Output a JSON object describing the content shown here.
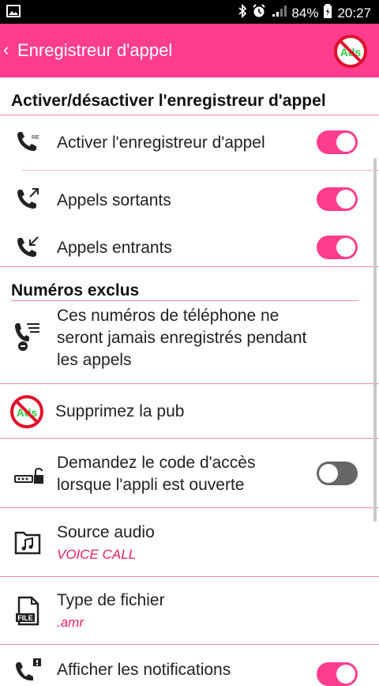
{
  "status_bar": {
    "battery": "84%",
    "time": "20:27",
    "icons": [
      "image-icon",
      "bluetooth-icon",
      "alarm-icon",
      "signal-icon",
      "battery-icon"
    ]
  },
  "app_bar": {
    "back_symbol": "‹",
    "title": "Enregistreur d'appel",
    "ads_text": "Ads"
  },
  "sections": {
    "recorder": {
      "header": "Activer/désactiver l'enregistreur d'appel",
      "items": [
        {
          "label": "Activer l'enregistreur d'appel",
          "icon": "phone-rec-icon",
          "toggle": true
        },
        {
          "label": "Appels sortants",
          "icon": "outgoing-call-icon",
          "toggle": true
        },
        {
          "label": "Appels entrants",
          "icon": "incoming-call-icon",
          "toggle": true
        }
      ]
    },
    "excluded": {
      "header": "Numéros exclus",
      "description_lines": [
        "Ces numéros de téléphone ne",
        "seront jamais enregistrés pendant",
        "les appels"
      ]
    },
    "remove_ads": {
      "label": "Supprimez la pub",
      "ads_text": "Ads"
    },
    "access_code": {
      "lines": [
        "Demandez le code d'accès",
        "lorsque l'appli est ouverte"
      ],
      "toggle": false
    },
    "audio_source": {
      "label": "Source audio",
      "value": "VOICE CALL"
    },
    "file_type": {
      "label": "Type de fichier",
      "value": ".amr",
      "icon_text": "FILE"
    },
    "notifications": {
      "label": "Afficher les notifications",
      "toggle": true
    }
  },
  "colors": {
    "accent": "#ff3d8f",
    "divider": "#f08aa6",
    "sub_value": "#e91e63"
  }
}
